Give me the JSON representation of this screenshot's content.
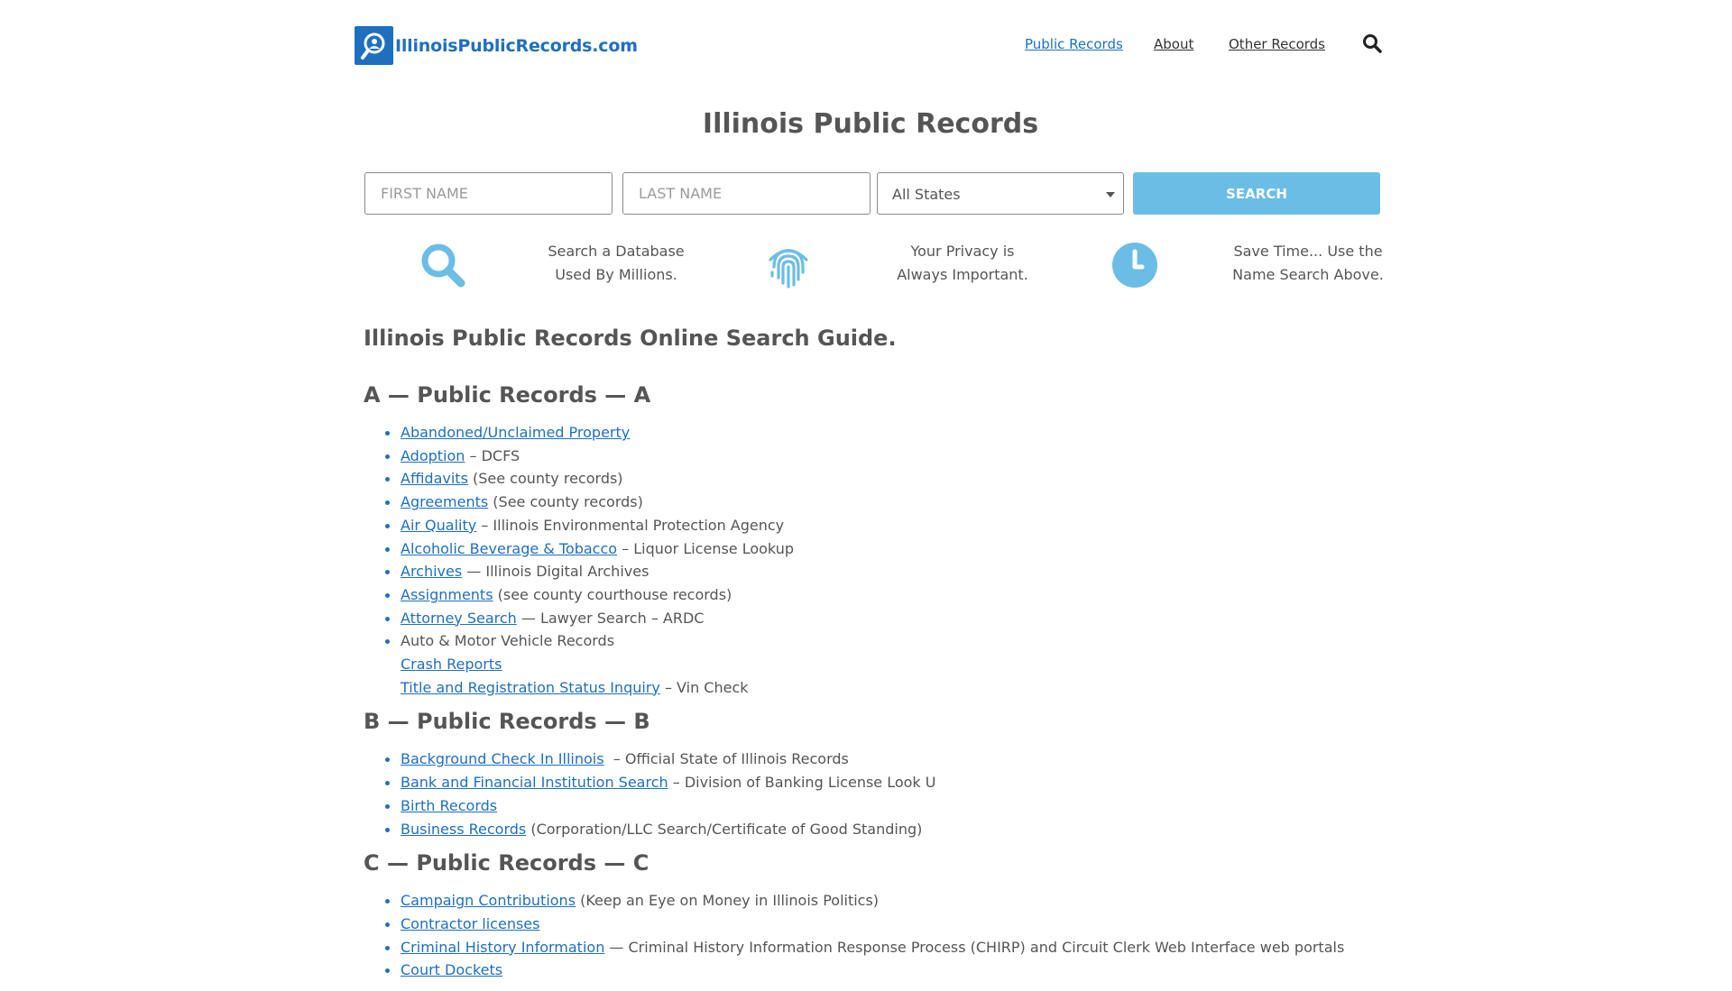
{
  "header": {
    "logo_text": "IllinoisPublicRecords.com",
    "nav": [
      {
        "label": "Public Records"
      },
      {
        "label": "About"
      },
      {
        "label": "Other Records"
      }
    ]
  },
  "title": "Illinois Public Records",
  "search": {
    "first_name_placeholder": "FIRST NAME",
    "last_name_placeholder": "LAST NAME",
    "state_value": "All States",
    "button_label": "SEARCH"
  },
  "features": [
    {
      "icon": "magnifier-icon",
      "line1": "Search a Database",
      "line2": "Used By Millions."
    },
    {
      "icon": "fingerprint-icon",
      "line1": "Your Privacy is",
      "line2": "Always Important."
    },
    {
      "icon": "clock-icon",
      "line1": "Save Time... Use the",
      "line2": "Name Search Above."
    }
  ],
  "guide_heading": "Illinois Public Records Online Search Guide.",
  "sections": {
    "a": {
      "heading": "A — Public Records — A",
      "items": [
        {
          "link": "Abandoned/Unclaimed Property",
          "note": ""
        },
        {
          "link": "Adoption",
          "note": " – DCFS"
        },
        {
          "link": "Affidavits",
          "note": " (See county records)"
        },
        {
          "link": "Agreements",
          "note": " (See county records)"
        },
        {
          "link": "Air Quality",
          "note": " – Illinois Environmental Protection Agency"
        },
        {
          "link": "Alcoholic Beverage & Tobacco",
          "note": " – Liquor License Lookup"
        },
        {
          "link": "Archives",
          "note": " — Illinois Digital Archives"
        },
        {
          "link": "Assignments",
          "note": " (see county courthouse records)"
        },
        {
          "link": "Attorney Search",
          "note": " — Lawyer Search – ARDC"
        }
      ],
      "auto": {
        "label": "Auto & Motor Vehicle Records",
        "sub1_link": "Crash Reports",
        "sub2_link": "Title and Registration Status Inquiry",
        "sub2_note": " – Vin Check"
      }
    },
    "b": {
      "heading": "B — Public Records — B",
      "items": [
        {
          "link": "Background Check In Illinois",
          "note": "  – Official State of Illinois Records"
        },
        {
          "link": "Bank and Financial Institution Search",
          "note": " – Division of Banking License Look U"
        },
        {
          "link": "Birth Records",
          "note": ""
        },
        {
          "link": "Business Records",
          "note": " (Corporation/LLC Search/Certificate of Good Standing)"
        }
      ]
    },
    "c": {
      "heading": "C — Public Records — C",
      "items": [
        {
          "link": "Campaign Contributions",
          "note": " (Keep an Eye on Money in Illinois Politics)"
        },
        {
          "link": "Contractor licenses",
          "note": ""
        },
        {
          "link": "Criminal History Information",
          "note": " — Criminal History Information Response Process (CHIRP) and Circuit Clerk Web Interface web portals"
        },
        {
          "link": "Court Dockets",
          "note": ""
        }
      ]
    }
  },
  "colors": {
    "brand_blue": "#1f6fbf",
    "accent_light_blue": "#6cbde6",
    "text_gray": "#555555"
  }
}
